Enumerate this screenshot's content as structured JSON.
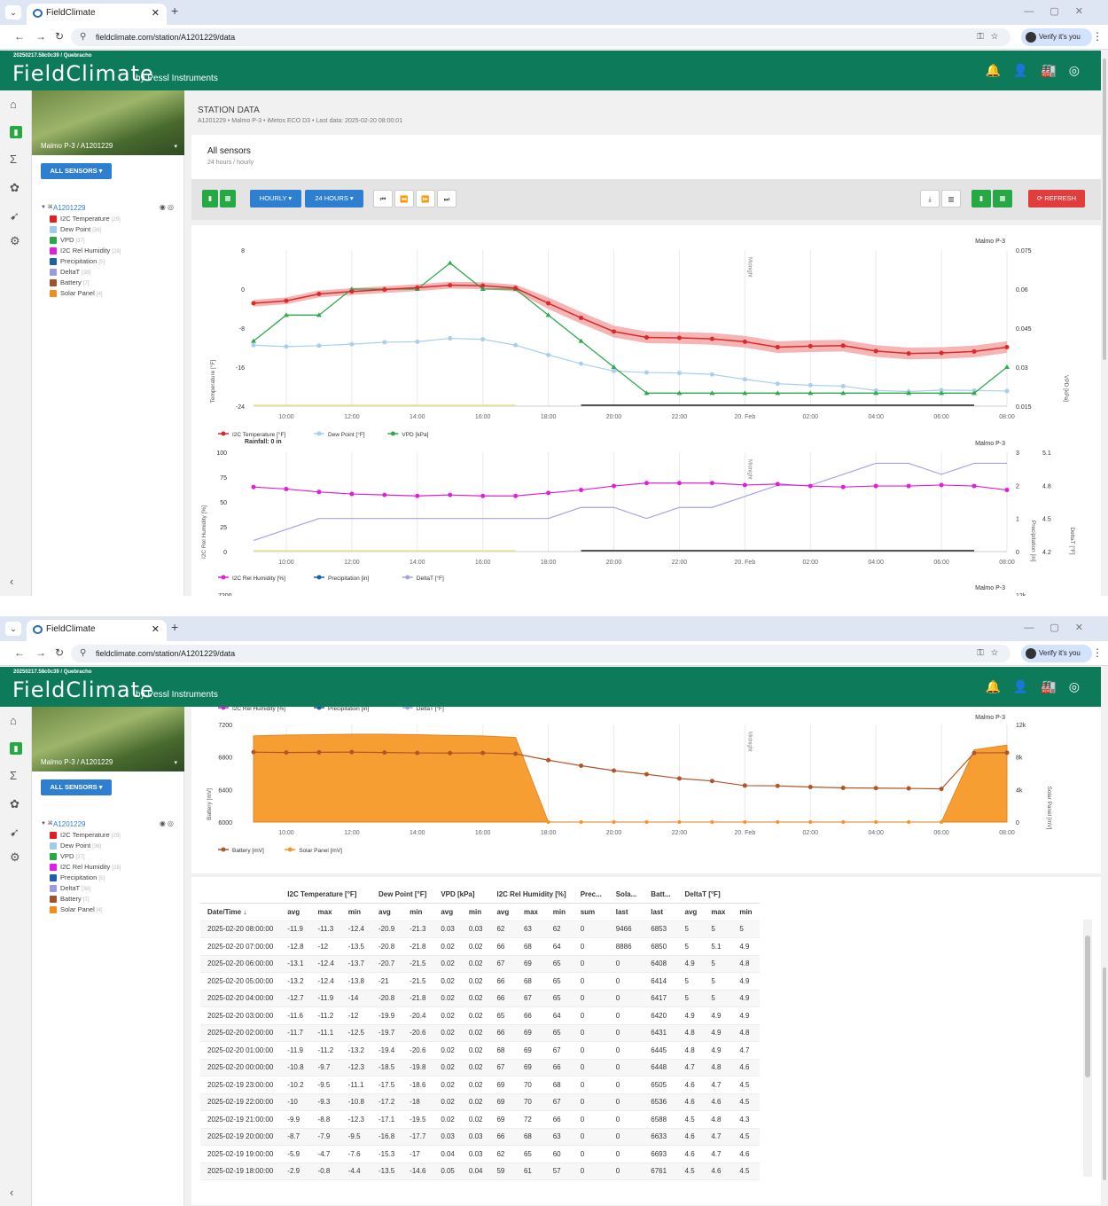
{
  "browser": {
    "tab_title": "FieldClimate",
    "url": "fieldclimate.com/station/A1201229/data",
    "profile": "Verify it's you"
  },
  "header": {
    "version": "20250217.58c0c39 / Quebracho",
    "logo": "FieldClimate",
    "tagline": "by Pessl Instruments"
  },
  "station": {
    "label": "Malmo P-3 / A1201229",
    "all_sensors": "ALL SENSORS",
    "node": "A1201229",
    "sensors": [
      {
        "name": "I2C Temperature",
        "code": "[29]",
        "color": "#e02020"
      },
      {
        "name": "Dew Point",
        "code": "[36]",
        "color": "#9fcbe8"
      },
      {
        "name": "VPD",
        "code": "[37]",
        "color": "#27a844"
      },
      {
        "name": "I2C Rel Humidity",
        "code": "[28]",
        "color": "#e020e0"
      },
      {
        "name": "Precipitation",
        "code": "[5]",
        "color": "#1f5fa8"
      },
      {
        "name": "DeltaT",
        "code": "[38]",
        "color": "#9b9be0"
      },
      {
        "name": "Battery",
        "code": "[7]",
        "color": "#a0522d"
      },
      {
        "name": "Solar Panel",
        "code": "[4]",
        "color": "#f28c1c"
      }
    ]
  },
  "main": {
    "title": "STATION DATA",
    "subtitle": "A1201229 • Malmo P-3 • iMetos ECO D3 • Last data: 2025-02-20 08:00:01",
    "card_title": "All sensors",
    "card_subtitle": "24 hours / hourly"
  },
  "toolbar": {
    "hourly": "HOURLY ▾",
    "range": "24 HOURS ▾",
    "refresh": "⟳ REFRESH"
  },
  "charts": {
    "station": "Malmo P-3",
    "midnight": "Midnight",
    "rainfall": "Rainfall: 0 in",
    "x_ticks": [
      "10:00",
      "12:00",
      "14:00",
      "16:00",
      "18:00",
      "20:00",
      "22:00",
      "20. Feb",
      "02:00",
      "04:00",
      "06:00",
      "08:00"
    ],
    "chart1": {
      "y_label": "Temperature [°F]",
      "y2_label": "VPD [kPa]",
      "y_ticks": [
        "8",
        "0",
        "-8",
        "-16",
        "-24"
      ],
      "y2_ticks": [
        "0.075",
        "0.06",
        "0.045",
        "0.03",
        "0.015"
      ],
      "legend": [
        "I2C Temperature [°F]",
        "Dew Point [°F]",
        "VPD [kPa]"
      ]
    },
    "chart2": {
      "y_label": "I2C Rel Humidity [%]",
      "y2_label": "Precipitation [in]",
      "y3_label": "DeltaT [°F]",
      "y_ticks": [
        "100",
        "75",
        "50",
        "25",
        "0"
      ],
      "y2_ticks": [
        "3",
        "2",
        "1",
        "0"
      ],
      "y3_ticks": [
        "5.1",
        "4.8",
        "4.5",
        "4.2"
      ],
      "legend": [
        "I2C Rel Humidity [%]",
        "Precipitation [in]",
        "DeltaT [°F]"
      ]
    },
    "chart3": {
      "y_label": "Battery [mV]",
      "y2_label": "Solar Panel [mV]",
      "y_ticks": [
        "7200",
        "6800",
        "6400",
        "6000"
      ],
      "y2_ticks": [
        "12k",
        "8k",
        "4k",
        "0"
      ],
      "legend": [
        "Battery [mV]",
        "Solar Panel [mV]"
      ],
      "peek": "7200",
      "peek2": "12k"
    }
  },
  "chart_data": [
    {
      "type": "line",
      "x": [
        "09:00",
        "10:00",
        "11:00",
        "12:00",
        "13:00",
        "14:00",
        "15:00",
        "16:00",
        "17:00",
        "18:00",
        "19:00",
        "20:00",
        "21:00",
        "22:00",
        "23:00",
        "20. Feb 00:00",
        "01:00",
        "02:00",
        "03:00",
        "04:00",
        "05:00",
        "06:00",
        "07:00",
        "08:00"
      ],
      "series": [
        {
          "name": "I2C Temperature [°F]",
          "values": [
            -2.9,
            -2.4,
            -1.0,
            -0.5,
            -0.1,
            0.3,
            0.8,
            0.7,
            0.2,
            -2.9,
            -5.9,
            -8.7,
            -9.9,
            -10,
            -10.2,
            -10.8,
            -11.9,
            -11.7,
            -11.6,
            -12.7,
            -13.2,
            -13.1,
            -12.8,
            -11.9
          ]
        },
        {
          "name": "Dew Point [°F]",
          "values": [
            -11.5,
            -11.8,
            -11.6,
            -11.3,
            -10.9,
            -10.8,
            -10.1,
            -10.3,
            -11.5,
            -13.5,
            -15.3,
            -16.8,
            -17.1,
            -17.2,
            -17.5,
            -18.5,
            -19.4,
            -19.7,
            -19.9,
            -20.8,
            -21,
            -20.7,
            -20.8,
            -20.9
          ]
        },
        {
          "name": "VPD [kPa]",
          "values": [
            0.04,
            0.05,
            0.05,
            0.06,
            0.06,
            0.06,
            0.07,
            0.06,
            0.06,
            0.05,
            0.04,
            0.03,
            0.02,
            0.02,
            0.02,
            0.02,
            0.02,
            0.02,
            0.02,
            0.02,
            0.02,
            0.02,
            0.02,
            0.03
          ]
        }
      ],
      "ylim": [
        -24,
        8
      ],
      "y2lim": [
        0.015,
        0.075
      ]
    },
    {
      "type": "line",
      "x": [
        "09:00",
        "10:00",
        "11:00",
        "12:00",
        "13:00",
        "14:00",
        "15:00",
        "16:00",
        "17:00",
        "18:00",
        "19:00",
        "20:00",
        "21:00",
        "22:00",
        "23:00",
        "20. Feb 00:00",
        "01:00",
        "02:00",
        "03:00",
        "04:00",
        "05:00",
        "06:00",
        "07:00",
        "08:00"
      ],
      "series": [
        {
          "name": "I2C Rel Humidity [%]",
          "values": [
            65,
            63,
            60,
            58,
            57,
            56,
            57,
            56,
            56,
            59,
            62,
            66,
            69,
            69,
            69,
            67,
            68,
            66,
            65,
            66,
            66,
            67,
            66,
            62
          ]
        },
        {
          "name": "Precipitation [in]",
          "values": [
            0,
            0,
            0,
            0,
            0,
            0,
            0,
            0,
            0,
            0,
            0,
            0,
            0,
            0,
            0,
            0,
            0,
            0,
            0,
            0,
            0,
            0,
            0,
            0
          ]
        },
        {
          "name": "DeltaT [°F]",
          "values": [
            4.3,
            4.4,
            4.5,
            4.5,
            4.5,
            4.5,
            4.5,
            4.5,
            4.5,
            4.5,
            4.6,
            4.6,
            4.5,
            4.6,
            4.6,
            4.7,
            4.8,
            4.8,
            4.9,
            5,
            5,
            4.9,
            5,
            5
          ]
        }
      ],
      "ylim": [
        0,
        100
      ],
      "y2lim": [
        0,
        3
      ],
      "y3lim": [
        4.2,
        5.1
      ]
    },
    {
      "type": "area",
      "x": [
        "09:00",
        "10:00",
        "11:00",
        "12:00",
        "13:00",
        "14:00",
        "15:00",
        "16:00",
        "17:00",
        "18:00",
        "19:00",
        "20:00",
        "21:00",
        "22:00",
        "23:00",
        "20. Feb 00:00",
        "01:00",
        "02:00",
        "03:00",
        "04:00",
        "05:00",
        "06:00",
        "07:00",
        "08:00"
      ],
      "series": [
        {
          "name": "Battery [mV]",
          "values": [
            6860,
            6855,
            6858,
            6860,
            6855,
            6850,
            6848,
            6850,
            6840,
            6761,
            6693,
            6633,
            6588,
            6536,
            6505,
            6448,
            6445,
            6431,
            6420,
            6417,
            6414,
            6408,
            6850,
            6853
          ]
        },
        {
          "name": "Solar Panel [mV]",
          "values": [
            10600,
            10700,
            10750,
            10800,
            10800,
            10750,
            10650,
            10600,
            10400,
            0,
            0,
            0,
            0,
            0,
            0,
            0,
            0,
            0,
            0,
            0,
            0,
            0,
            8886,
            9466
          ]
        }
      ],
      "ylim": [
        6000,
        7200
      ],
      "y2lim": [
        0,
        12000
      ]
    }
  ],
  "table": {
    "groups": [
      "I2C Temperature [°F]",
      "Dew Point [°F]",
      "VPD [kPa]",
      "I2C Rel Humidity [%]",
      "Prec...",
      "Sola...",
      "Batt...",
      "DeltaT [°F]"
    ],
    "sub": [
      "Date/Time ↓",
      "avg",
      "max",
      "min",
      "avg",
      "min",
      "avg",
      "min",
      "avg",
      "max",
      "min",
      "sum",
      "last",
      "last",
      "avg",
      "max",
      "min"
    ],
    "rows": [
      [
        "2025-02-20 08:00:00",
        "-11.9",
        "-11.3",
        "-12.4",
        "-20.9",
        "-21.3",
        "0.03",
        "0.03",
        "62",
        "63",
        "62",
        "0",
        "9466",
        "6853",
        "5",
        "5",
        "5"
      ],
      [
        "2025-02-20 07:00:00",
        "-12.8",
        "-12",
        "-13.5",
        "-20.8",
        "-21.8",
        "0.02",
        "0.02",
        "66",
        "68",
        "64",
        "0",
        "8886",
        "6850",
        "5",
        "5.1",
        "4.9"
      ],
      [
        "2025-02-20 06:00:00",
        "-13.1",
        "-12.4",
        "-13.7",
        "-20.7",
        "-21.5",
        "0.02",
        "0.02",
        "67",
        "69",
        "65",
        "0",
        "0",
        "6408",
        "4.9",
        "5",
        "4.8"
      ],
      [
        "2025-02-20 05:00:00",
        "-13.2",
        "-12.4",
        "-13.8",
        "-21",
        "-21.5",
        "0.02",
        "0.02",
        "66",
        "68",
        "65",
        "0",
        "0",
        "6414",
        "5",
        "5",
        "4.9"
      ],
      [
        "2025-02-20 04:00:00",
        "-12.7",
        "-11.9",
        "-14",
        "-20.8",
        "-21.8",
        "0.02",
        "0.02",
        "66",
        "67",
        "65",
        "0",
        "0",
        "6417",
        "5",
        "5",
        "4.9"
      ],
      [
        "2025-02-20 03:00:00",
        "-11.6",
        "-11.2",
        "-12",
        "-19.9",
        "-20.4",
        "0.02",
        "0.02",
        "65",
        "66",
        "64",
        "0",
        "0",
        "6420",
        "4.9",
        "4.9",
        "4.9"
      ],
      [
        "2025-02-20 02:00:00",
        "-11.7",
        "-11.1",
        "-12.5",
        "-19.7",
        "-20.6",
        "0.02",
        "0.02",
        "66",
        "69",
        "65",
        "0",
        "0",
        "6431",
        "4.8",
        "4.9",
        "4.8"
      ],
      [
        "2025-02-20 01:00:00",
        "-11.9",
        "-11.2",
        "-13.2",
        "-19.4",
        "-20.6",
        "0.02",
        "0.02",
        "68",
        "69",
        "67",
        "0",
        "0",
        "6445",
        "4.8",
        "4.9",
        "4.7"
      ],
      [
        "2025-02-20 00:00:00",
        "-10.8",
        "-9.7",
        "-12.3",
        "-18.5",
        "-19.8",
        "0.02",
        "0.02",
        "67",
        "69",
        "66",
        "0",
        "0",
        "6448",
        "4.7",
        "4.8",
        "4.6"
      ],
      [
        "2025-02-19 23:00:00",
        "-10.2",
        "-9.5",
        "-11.1",
        "-17.5",
        "-18.6",
        "0.02",
        "0.02",
        "69",
        "70",
        "68",
        "0",
        "0",
        "6505",
        "4.6",
        "4.7",
        "4.5"
      ],
      [
        "2025-02-19 22:00:00",
        "-10",
        "-9.3",
        "-10.8",
        "-17.2",
        "-18",
        "0.02",
        "0.02",
        "69",
        "70",
        "67",
        "0",
        "0",
        "6536",
        "4.6",
        "4.6",
        "4.5"
      ],
      [
        "2025-02-19 21:00:00",
        "-9.9",
        "-8.8",
        "-12.3",
        "-17.1",
        "-19.5",
        "0.02",
        "0.02",
        "69",
        "72",
        "66",
        "0",
        "0",
        "6588",
        "4.5",
        "4.8",
        "4.3"
      ],
      [
        "2025-02-19 20:00:00",
        "-8.7",
        "-7.9",
        "-9.5",
        "-16.8",
        "-17.7",
        "0.03",
        "0.03",
        "66",
        "68",
        "63",
        "0",
        "0",
        "6633",
        "4.6",
        "4.7",
        "4.5"
      ],
      [
        "2025-02-19 19:00:00",
        "-5.9",
        "-4.7",
        "-7.6",
        "-15.3",
        "-17",
        "0.04",
        "0.03",
        "62",
        "65",
        "60",
        "0",
        "0",
        "6693",
        "4.6",
        "4.7",
        "4.6"
      ],
      [
        "2025-02-19 18:00:00",
        "-2.9",
        "-0.8",
        "-4.4",
        "-13.5",
        "-14.6",
        "0.05",
        "0.04",
        "59",
        "61",
        "57",
        "0",
        "0",
        "6761",
        "4.5",
        "4.6",
        "4.5"
      ]
    ]
  }
}
